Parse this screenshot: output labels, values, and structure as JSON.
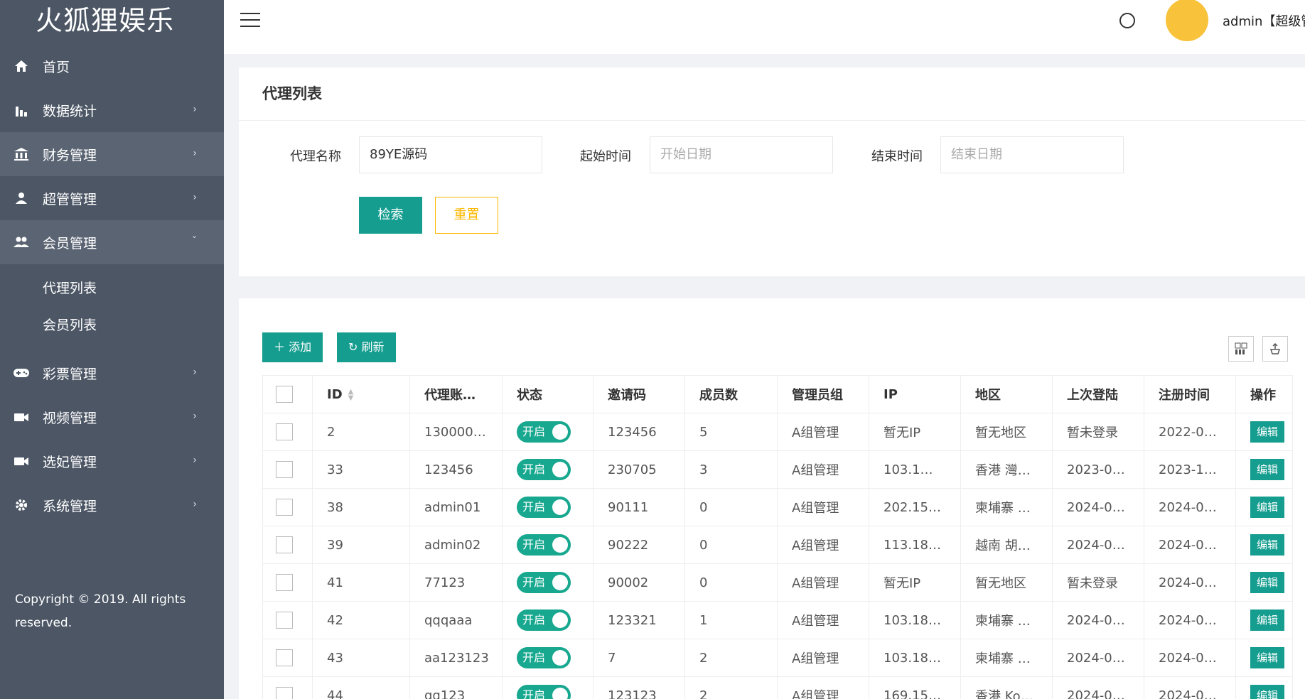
{
  "app": {
    "logo_text": "火狐狸娱乐",
    "user": "admin【超级管",
    "copyright": "Copyright © 2019. All rights reserved."
  },
  "sidebar": {
    "items": [
      {
        "label": "首页",
        "icon": "home-icon",
        "has_children": false
      },
      {
        "label": "数据统计",
        "icon": "bar-chart-icon",
        "has_children": true
      },
      {
        "label": "财务管理",
        "icon": "bank-icon",
        "has_children": true
      },
      {
        "label": "超管管理",
        "icon": "user-icon",
        "has_children": true
      },
      {
        "label": "会员管理",
        "icon": "users-icon",
        "has_children": true,
        "expanded": true
      },
      {
        "label": "彩票管理",
        "icon": "gamepad-icon",
        "has_children": true
      },
      {
        "label": "视频管理",
        "icon": "video-icon",
        "has_children": true
      },
      {
        "label": "选妃管理",
        "icon": "camera-icon",
        "has_children": true
      },
      {
        "label": "系统管理",
        "icon": "gear-icon",
        "has_children": true
      }
    ],
    "submenu": [
      "代理列表",
      "会员列表"
    ]
  },
  "search": {
    "title": "代理列表",
    "agent_name_label": "代理名称",
    "agent_name_value": "89YE源码",
    "start_label": "起始时间",
    "start_placeholder": "开始日期",
    "end_label": "结束时间",
    "end_placeholder": "结束日期",
    "search_button": "检索",
    "reset_button": "重置"
  },
  "toolbar": {
    "add_label": "添加",
    "refresh_label": "刷新"
  },
  "table": {
    "columns": [
      "ID",
      "代理账…",
      "状态",
      "邀请码",
      "成员数",
      "管理员组",
      "IP",
      "地区",
      "上次登陆",
      "注册时间",
      "操作"
    ],
    "rows": [
      {
        "id": "2",
        "account": "130000…",
        "status": "开启",
        "code": "123456",
        "members": "5",
        "group": "A组管理",
        "ip": "暂无IP",
        "region": "暂无地区",
        "last_login": "暂未登录",
        "registered": "2022-0…",
        "action": "编辑"
      },
      {
        "id": "33",
        "account": "123456",
        "status": "开启",
        "code": "230705",
        "members": "3",
        "group": "A组管理",
        "ip": "103.1…",
        "region": "香港 灣…",
        "last_login": "2023-0…",
        "registered": "2023-1…",
        "action": "编辑"
      },
      {
        "id": "38",
        "account": "admin01",
        "status": "开启",
        "code": "90111",
        "members": "0",
        "group": "A组管理",
        "ip": "202.15…",
        "region": "柬埔寨 …",
        "last_login": "2024-0…",
        "registered": "2024-0…",
        "action": "编辑"
      },
      {
        "id": "39",
        "account": "admin02",
        "status": "开启",
        "code": "90222",
        "members": "0",
        "group": "A组管理",
        "ip": "113.18…",
        "region": "越南 胡…",
        "last_login": "2024-0…",
        "registered": "2024-0…",
        "action": "编辑"
      },
      {
        "id": "41",
        "account": "77123",
        "status": "开启",
        "code": "90002",
        "members": "0",
        "group": "A组管理",
        "ip": "暂无IP",
        "region": "暂无地区",
        "last_login": "暂未登录",
        "registered": "2024-0…",
        "action": "编辑"
      },
      {
        "id": "42",
        "account": "qqqaaa",
        "status": "开启",
        "code": "123321",
        "members": "1",
        "group": "A组管理",
        "ip": "103.18…",
        "region": "柬埔寨 …",
        "last_login": "2024-0…",
        "registered": "2024-0…",
        "action": "编辑"
      },
      {
        "id": "43",
        "account": "aa123123",
        "status": "开启",
        "code": "7",
        "members": "2",
        "group": "A组管理",
        "ip": "103.18…",
        "region": "柬埔寨 …",
        "last_login": "2024-0…",
        "registered": "2024-0…",
        "action": "编辑"
      },
      {
        "id": "44",
        "account": "qq123",
        "status": "开启",
        "code": "123123",
        "members": "2",
        "group": "A组管理",
        "ip": "169.15…",
        "region": "香港 Ko…",
        "last_login": "2024-0…",
        "registered": "2024-0…",
        "action": "编辑"
      }
    ]
  },
  "colors": {
    "sidebar_bg": "#4c5665",
    "accent": "#159d8f",
    "toggle_on": "#17a88f",
    "reset_border": "#ffb800"
  }
}
